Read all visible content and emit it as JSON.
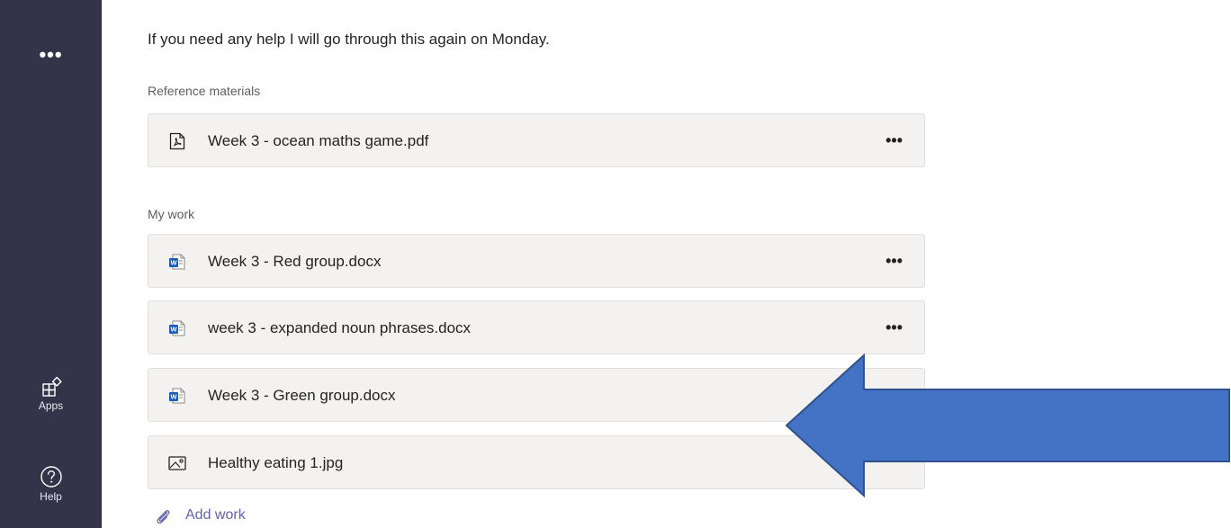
{
  "rail": {
    "more_label": "•••",
    "apps_label": "Apps",
    "help_label": "Help"
  },
  "intro_text": "If you need any help I will go through this again on Monday.",
  "reference": {
    "label": "Reference materials",
    "files": [
      {
        "name": "Week 3 - ocean maths game.pdf",
        "icon": "pdf-file-icon",
        "more": "•••"
      }
    ]
  },
  "my_work": {
    "label": "My work",
    "files": [
      {
        "name": "Week 3 - Red group.docx",
        "icon": "word-file-icon",
        "more": "•••"
      },
      {
        "name": "week 3 - expanded noun phrases.docx",
        "icon": "word-file-icon",
        "more": "•••"
      },
      {
        "name": "Week 3 - Green group.docx",
        "icon": "word-file-icon",
        "more": "•••"
      },
      {
        "name": "Healthy eating 1.jpg",
        "icon": "image-file-icon",
        "more": ""
      }
    ],
    "add_work_label": "Add work"
  },
  "colors": {
    "rail_bg": "#33344a",
    "accent": "#6264a7",
    "word_blue": "#185abd",
    "arrow_fill": "#4472c4",
    "arrow_stroke": "#2f528f"
  }
}
